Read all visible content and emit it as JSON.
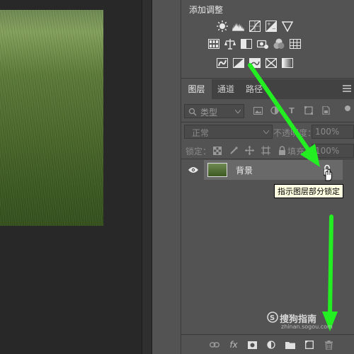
{
  "adjustments": {
    "title": "添加调整",
    "row1_icons": [
      "brightness-contrast-icon",
      "levels-icon",
      "curves-icon",
      "exposure-icon",
      "vibrance-icon"
    ],
    "row2_icons": [
      "hue-saturation-icon",
      "color-balance-icon",
      "black-white-icon",
      "photo-filter-icon",
      "channel-mixer-icon",
      "color-lookup-icon"
    ],
    "row3_icons": [
      "invert-icon",
      "posterize-icon",
      "threshold-icon",
      "selective-color-icon",
      "gradient-map-icon"
    ]
  },
  "tabs": [
    {
      "label": "图层",
      "active": true
    },
    {
      "label": "通道",
      "active": false
    },
    {
      "label": "路径",
      "active": false
    }
  ],
  "filter": {
    "kind_label": "类型",
    "icons": [
      "image-filter-icon",
      "adjustment-filter-icon",
      "type-filter-icon",
      "shape-filter-icon",
      "smart-object-filter-icon"
    ],
    "type_glyph": "T"
  },
  "blend": {
    "mode": "正常",
    "opacity_label": "不透明度：",
    "opacity_value": "100%",
    "lock_label": "锁定：",
    "fill_label": "填充：",
    "fill_value": "100%"
  },
  "layers": [
    {
      "name": "背景",
      "visible": true,
      "locked": true,
      "selected": true
    }
  ],
  "tooltip": "指示图层部分锁定",
  "bottom_icons": [
    "link-layers-icon",
    "fx-icon",
    "layer-mask-icon",
    "adjustment-layer-icon",
    "group-folder-icon",
    "new-layer-icon",
    "trash-icon"
  ],
  "fx_label": "fx",
  "watermark": {
    "text": "搜狗指南",
    "url": "zhinan.sogou.com"
  },
  "colors": {
    "panel": "#535353",
    "arrow": "#22ee22",
    "tooltip_bg": "#ffffe1"
  }
}
